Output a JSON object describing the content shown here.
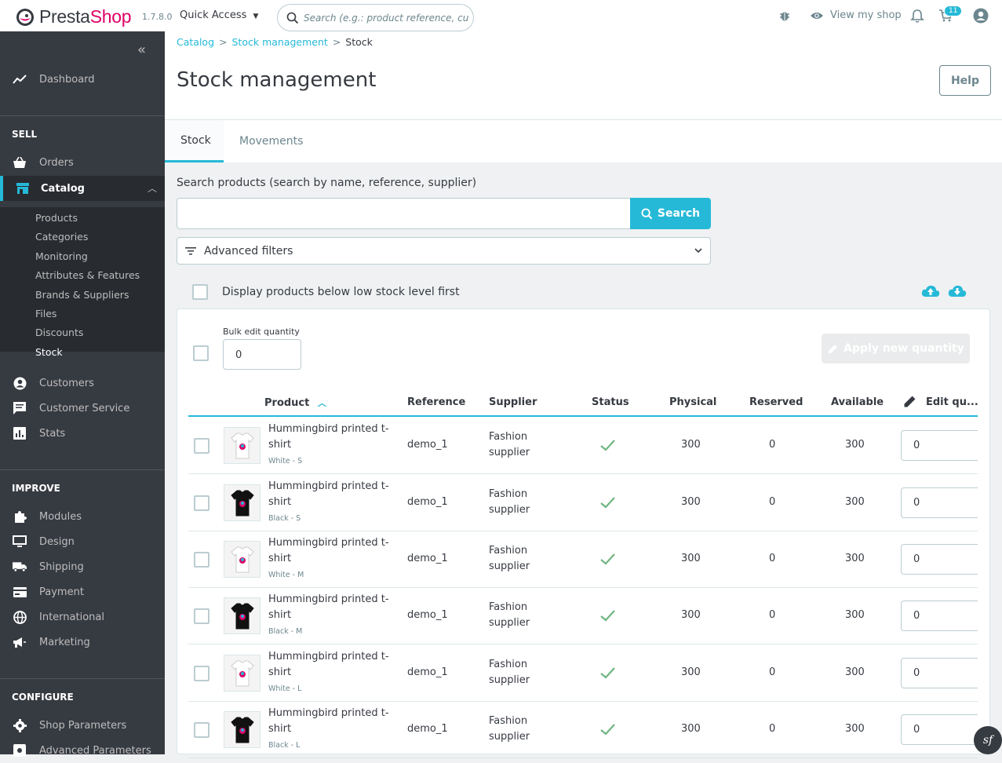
{
  "topbar": {
    "logo_presta": "Presta",
    "logo_shop": "Shop",
    "version": "1.7.8.0",
    "quick_access": "Quick Access",
    "search_placeholder": "Search (e.g.: product reference, custom",
    "view_shop": "View my shop",
    "cart_badge": "11"
  },
  "sidebar": {
    "dashboard": "Dashboard",
    "sell_section": "SELL",
    "orders": "Orders",
    "catalog": "Catalog",
    "submenu": [
      "Products",
      "Categories",
      "Monitoring",
      "Attributes & Features",
      "Brands & Suppliers",
      "Files",
      "Discounts",
      "Stock"
    ],
    "customers": "Customers",
    "customer_service": "Customer Service",
    "stats": "Stats",
    "improve_section": "IMPROVE",
    "modules": "Modules",
    "design": "Design",
    "shipping": "Shipping",
    "payment": "Payment",
    "international": "International",
    "marketing": "Marketing",
    "configure_section": "CONFIGURE",
    "shop_parameters": "Shop Parameters",
    "advanced_parameters": "Advanced Parameters"
  },
  "header": {
    "breadcrumb": [
      "Catalog",
      "Stock management",
      "Stock"
    ],
    "title": "Stock management",
    "help": "Help"
  },
  "tabs": [
    "Stock",
    "Movements"
  ],
  "search": {
    "label": "Search products (search by name, reference, supplier)",
    "button": "Search",
    "value": ""
  },
  "filters": {
    "advanced": "Advanced filters",
    "low_stock": "Display products below low stock level first"
  },
  "bulk": {
    "label": "Bulk edit quantity",
    "value": "0",
    "apply": "Apply new quantity"
  },
  "table": {
    "headers": [
      "Product",
      "Reference",
      "Supplier",
      "Status",
      "Physical",
      "Reserved",
      "Available",
      "Edit qu..."
    ],
    "rows": [
      {
        "name": "Hummingbird printed t-shirt",
        "variant": "White - S",
        "color": "white",
        "reference": "demo_1",
        "supplier": "Fashion supplier",
        "physical": "300",
        "reserved": "0",
        "available": "300",
        "edit": "0"
      },
      {
        "name": "Hummingbird printed t-shirt",
        "variant": "Black - S",
        "color": "black",
        "reference": "demo_1",
        "supplier": "Fashion supplier",
        "physical": "300",
        "reserved": "0",
        "available": "300",
        "edit": "0"
      },
      {
        "name": "Hummingbird printed t-shirt",
        "variant": "White - M",
        "color": "white",
        "reference": "demo_1",
        "supplier": "Fashion supplier",
        "physical": "300",
        "reserved": "0",
        "available": "300",
        "edit": "0"
      },
      {
        "name": "Hummingbird printed t-shirt",
        "variant": "Black - M",
        "color": "black",
        "reference": "demo_1",
        "supplier": "Fashion supplier",
        "physical": "300",
        "reserved": "0",
        "available": "300",
        "edit": "0"
      },
      {
        "name": "Hummingbird printed t-shirt",
        "variant": "White - L",
        "color": "white",
        "reference": "demo_1",
        "supplier": "Fashion supplier",
        "physical": "300",
        "reserved": "0",
        "available": "300",
        "edit": "0"
      },
      {
        "name": "Hummingbird printed t-shirt",
        "variant": "Black - L",
        "color": "black",
        "reference": "demo_1",
        "supplier": "Fashion supplier",
        "physical": "300",
        "reserved": "0",
        "available": "300",
        "edit": "0"
      }
    ]
  },
  "colors": {
    "accent": "#25b9d7",
    "sidebar": "#363a41",
    "brand_pink": "#df0067",
    "success": "#70b580"
  }
}
